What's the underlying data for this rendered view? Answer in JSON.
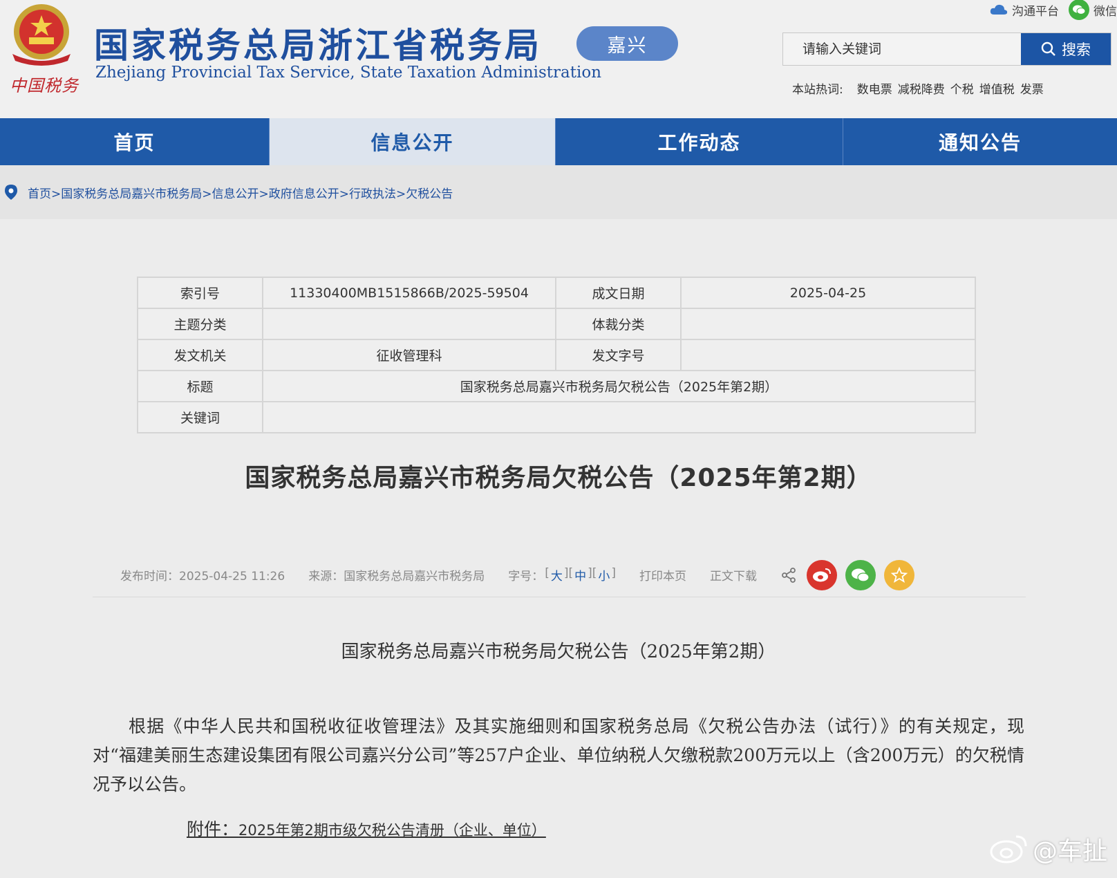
{
  "header": {
    "title_cn": "国家税务总局浙江省税务局",
    "title_en": "Zhejiang Provincial Tax Service, State Taxation Administration",
    "brand_script": "中国税务",
    "city_badge": "嘉兴",
    "top_links": [
      {
        "label": "沟通平台",
        "icon": "cloud-icon"
      },
      {
        "label": "微信",
        "icon": "wechat-icon"
      }
    ],
    "search": {
      "placeholder": "请输入关键词",
      "button_label": "搜索"
    },
    "hot_words_label": "本站热词:",
    "hot_words": [
      "数电票",
      "减税降费",
      "个税",
      "增值税",
      "发票"
    ]
  },
  "nav": {
    "items": [
      {
        "label": "首页",
        "active": false
      },
      {
        "label": "信息公开",
        "active": true
      },
      {
        "label": "工作动态",
        "active": false
      },
      {
        "label": "通知公告",
        "active": false
      }
    ]
  },
  "breadcrumb": "首页>国家税务总局嘉兴市税务局>信息公开>政府信息公开>行政执法>欠税公告",
  "meta": {
    "index_label": "索引号",
    "index_value": "11330400MB1515866B/2025-59504",
    "date_label": "成文日期",
    "date_value": "2025-04-25",
    "topic_label": "主题分类",
    "topic_value": "",
    "genre_label": "体裁分类",
    "genre_value": "",
    "issuer_label": "发文机关",
    "issuer_value": "征收管理科",
    "docno_label": "发文字号",
    "docno_value": "",
    "title_label": "标题",
    "title_value": "国家税务总局嘉兴市税务局欠税公告（2025年第2期）",
    "keywords_label": "关键词",
    "keywords_value": ""
  },
  "document": {
    "title": "国家税务总局嘉兴市税务局欠税公告（2025年第2期）",
    "publish_time": "发布时间：2025-04-25  11:26",
    "source": "来源：国家税务总局嘉兴市税务局",
    "font_size_label": "字号：",
    "font_sizes": [
      "大",
      "中",
      "小"
    ],
    "print_label": "打印本页",
    "download_label": "正文下载",
    "content_heading": "国家税务总局嘉兴市税务局欠税公告（2025年第2期）",
    "body": "根据《中华人民共和国税收征收管理法》及其实施细则和国家税务总局《欠税公告办法（试行）》的有关规定，现对“福建美丽生态建设集团有限公司嘉兴分公司”等257户企业、单位纳税人欠缴税款200万元以上（含200万元）的欠税情况予以公告。",
    "attachment_label": "附件：",
    "attachment_name": "2025年第2期市级欠税公告清册（企业、单位）"
  },
  "watermark": "@车扯",
  "colors": {
    "brand_blue": "#1f5aa8",
    "title_blue": "#1f4f9e",
    "badge_blue": "#5b85c9",
    "weibo_red": "#d9352d",
    "wechat_green": "#4db348",
    "fav_gold": "#f0b63a"
  }
}
